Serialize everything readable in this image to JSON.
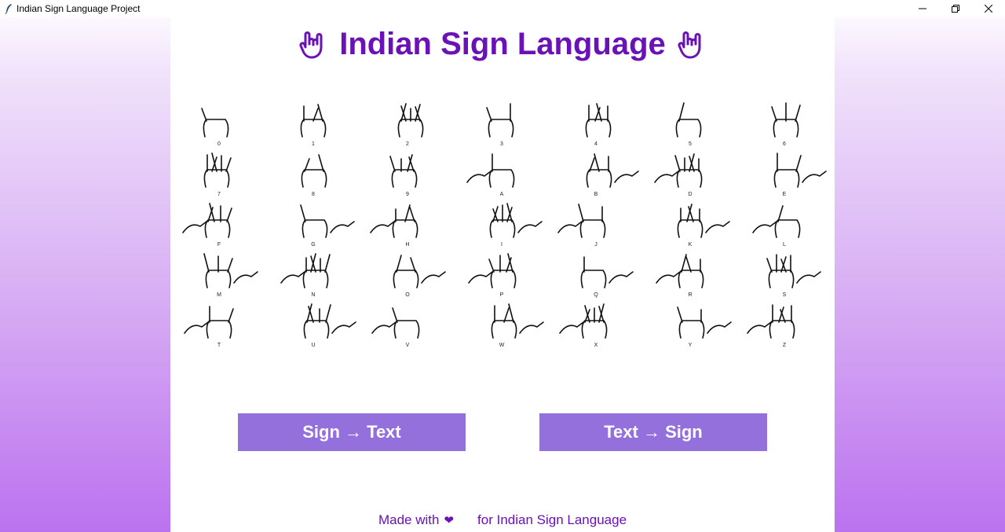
{
  "window": {
    "title": "Indian Sign Language Project",
    "icon": "feather-icon"
  },
  "header": {
    "title": "Indian Sign Language",
    "emoji": "love-you-hand-icon"
  },
  "signs": [
    "0",
    "1",
    "2",
    "3",
    "4",
    "5",
    "6",
    "7",
    "8",
    "9",
    "A",
    "B",
    "D",
    "E",
    "F",
    "G",
    "H",
    "I",
    "J",
    "K",
    "L",
    "M",
    "N",
    "O",
    "P",
    "Q",
    "R",
    "S",
    "T",
    "U",
    "V",
    "W",
    "X",
    "Y",
    "Z"
  ],
  "buttons": {
    "sign_to_text": "Sign → Text",
    "text_to_sign": "Text → Sign"
  },
  "footer": {
    "made_with": "Made with",
    "heart": "❤",
    "suffix": "for Indian Sign Language"
  },
  "colors": {
    "accent": "#6a12b5",
    "button": "#9370db"
  }
}
